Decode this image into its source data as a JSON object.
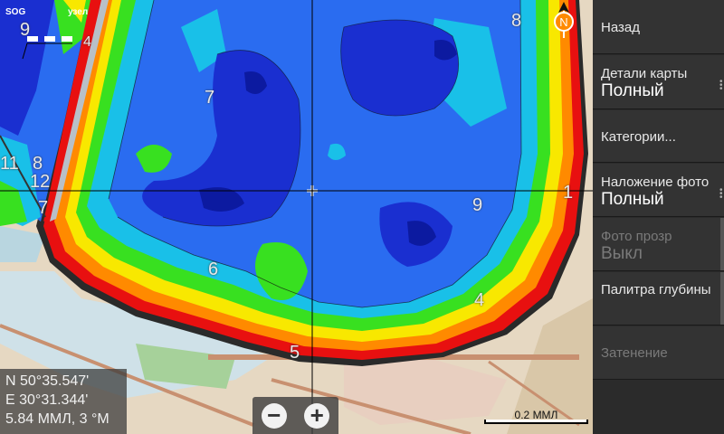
{
  "map": {
    "sog_label": "SOG",
    "knot_label": "узел",
    "depth_labels": [
      "9",
      "4",
      "7",
      "8",
      "11",
      "8",
      "12",
      "7",
      "6",
      "5",
      "9",
      "4",
      "1",
      "8"
    ],
    "coordinates": {
      "lat": "N  50°35.547'",
      "lon": "E  30°31.344'",
      "dist": "5.84 ММЛ, 3 °М"
    },
    "scale_label": "0.2 ММЛ",
    "zoom_out": "−",
    "zoom_in": "+",
    "compass_letter": "N"
  },
  "menu": {
    "items": [
      {
        "label": "Назад",
        "value": "",
        "disabled": false
      },
      {
        "label": "Детали карты",
        "value": "Полный",
        "disabled": false
      },
      {
        "label": "Категории...",
        "value": "",
        "disabled": false
      },
      {
        "label": "Наложение фото",
        "value": "Полный",
        "disabled": false
      },
      {
        "label": "Фото прозр",
        "value": "Выкл",
        "disabled": true
      },
      {
        "label": "Палитра глубины",
        "value": "",
        "disabled": false
      },
      {
        "label": "Затенение",
        "value": "",
        "disabled": true
      }
    ]
  },
  "colors": {
    "deep": "#1a2fd0",
    "mid": "#2a6cf0",
    "shallow": "#19c0e8",
    "green": "#38e020",
    "yellow": "#f8e800",
    "orange": "#ff8a00",
    "red": "#e81010",
    "menu_bg": "#333333"
  }
}
